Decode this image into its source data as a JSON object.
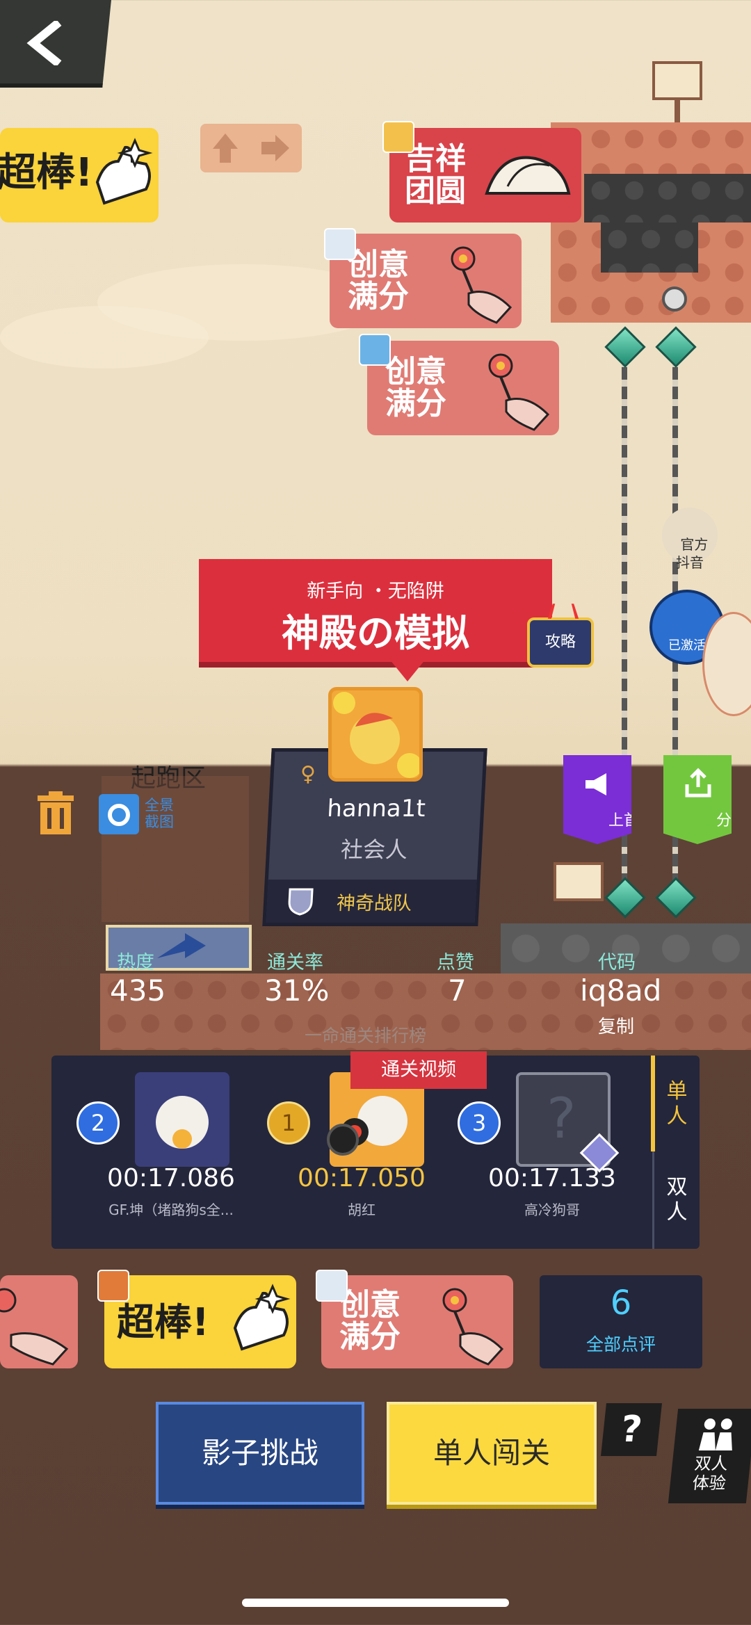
{
  "nav": {
    "back_icon": "chevron-left-icon"
  },
  "stickers": {
    "great": "超棒!",
    "creative": "创意\n满分",
    "lucky": "吉祥\n团圆"
  },
  "level": {
    "tags": "新手向 ・无陷阱",
    "name": "神殿の模拟",
    "guide_label": "攻略"
  },
  "author": {
    "gender_icon": "♀",
    "name": "hanna1t",
    "title": "社会人",
    "team": "神奇战队"
  },
  "start_zone": {
    "label": "起跑区",
    "screenshot_label": "全景\n截图"
  },
  "side": {
    "official_label": "官方\n抖音",
    "activated_label": "已激活",
    "homepage_label": "上首页",
    "share_label": "分享"
  },
  "stats": {
    "heat_label": "热度",
    "heat_value": "435",
    "clear_rate_label": "通关率",
    "clear_rate_value": "31%",
    "likes_label": "点赞",
    "likes_value": "7",
    "code_label": "代码",
    "code_value": "iq8ad",
    "copy_label": "复制"
  },
  "leaderboard": {
    "title": "一命通关排行榜",
    "video_tag": "通关视频",
    "tab_single": "单\n人",
    "tab_double": "双\n人",
    "entries": [
      {
        "rank": "2",
        "time": "00:17.086",
        "name": "GF.坤（堵路狗s全..."
      },
      {
        "rank": "1",
        "time": "00:17.050",
        "name": "胡红"
      },
      {
        "rank": "3",
        "time": "00:17.133",
        "name": "高冷狗哥"
      }
    ]
  },
  "reviews": {
    "count": "6",
    "label": "全部点评"
  },
  "actions": {
    "shadow_challenge": "影子挑战",
    "single_play": "单人闯关",
    "help": "?",
    "duo_label": "双人\n体验"
  },
  "colors": {
    "accent_red": "#dc2f3d",
    "board_bg": "#24263b",
    "gold": "#f5c542",
    "teal": "#8ce8d8"
  }
}
